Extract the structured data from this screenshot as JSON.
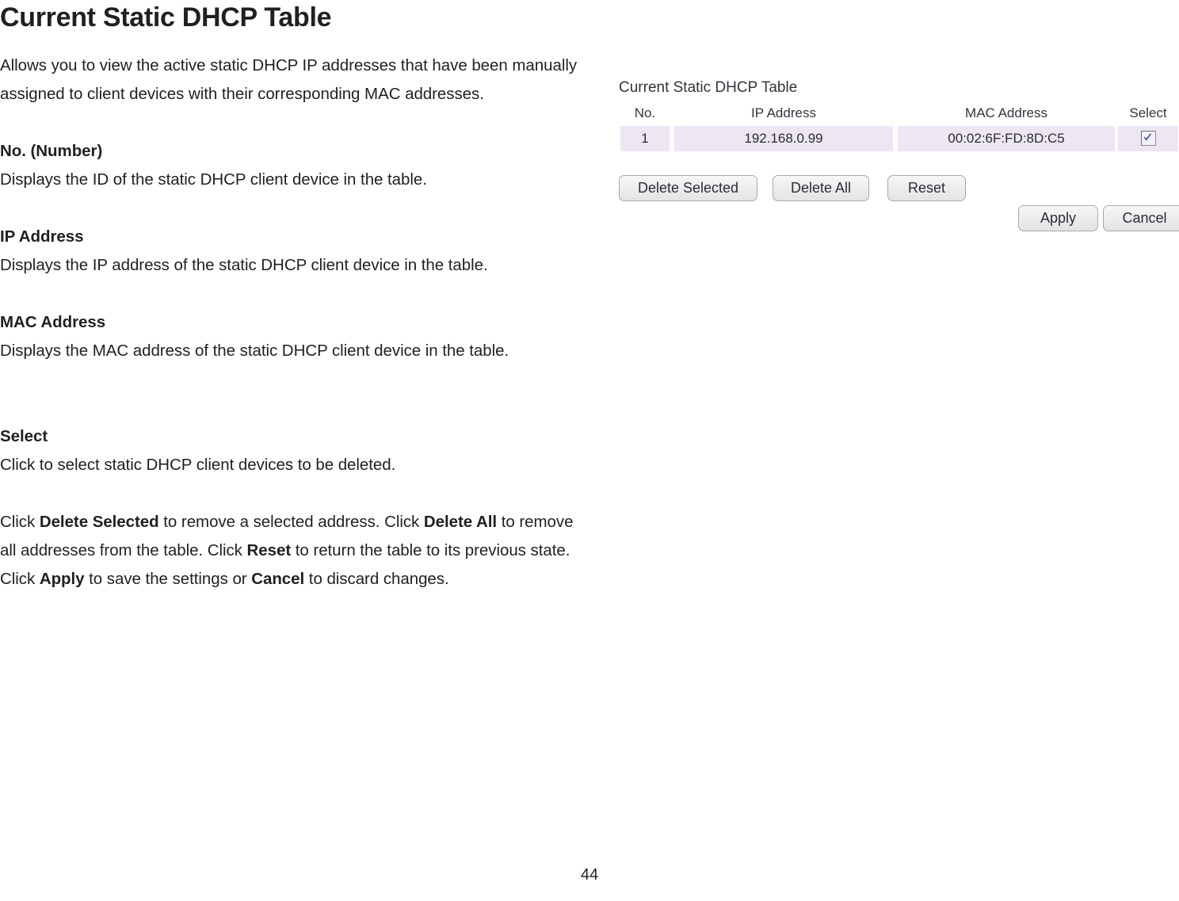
{
  "document": {
    "title": "Current Static DHCP Table",
    "page_number": "44",
    "intro": "Allows you to view the active static DHCP IP addresses that have been manually assigned to client devices with their corresponding MAC addresses.",
    "sections": [
      {
        "heading": "No. (Number)",
        "body": "Displays the ID of the static DHCP client device in the table."
      },
      {
        "heading": "IP Address",
        "body": "Displays the IP address of the static DHCP client device in the table."
      },
      {
        "heading": "MAC Address",
        "body": "Displays the MAC address of the static DHCP client device in the table."
      },
      {
        "heading": "Select",
        "body": "Click to select static DHCP client devices to be deleted."
      }
    ],
    "closing_paragraph": {
      "part1": "Click ",
      "bold1": "Delete Selected",
      "part2": " to remove a selected address. Click ",
      "bold2": "Delete All",
      "part3": " to remove all addresses from the table. Click ",
      "bold3": "Reset",
      "part4": " to return the table to its previous state. Click ",
      "bold4": "Apply",
      "part5": " to save the settings or ",
      "bold5": "Cancel",
      "part6": " to discard changes."
    }
  },
  "ui_screenshot": {
    "caption": "Current Static DHCP Table",
    "table": {
      "columns": [
        "No.",
        "IP Address",
        "MAC Address",
        "Select"
      ],
      "rows": [
        {
          "no": "1",
          "ip_address": "192.168.0.99",
          "mac_address": "00:02:6F:FD:8D:C5",
          "selected": true
        }
      ],
      "row_background": "#ece7f3",
      "checkbox_check_color": "#3f51a8"
    },
    "buttons": {
      "delete_selected": "Delete Selected",
      "delete_all": "Delete All",
      "reset": "Reset",
      "apply": "Apply",
      "cancel": "Cancel"
    }
  }
}
